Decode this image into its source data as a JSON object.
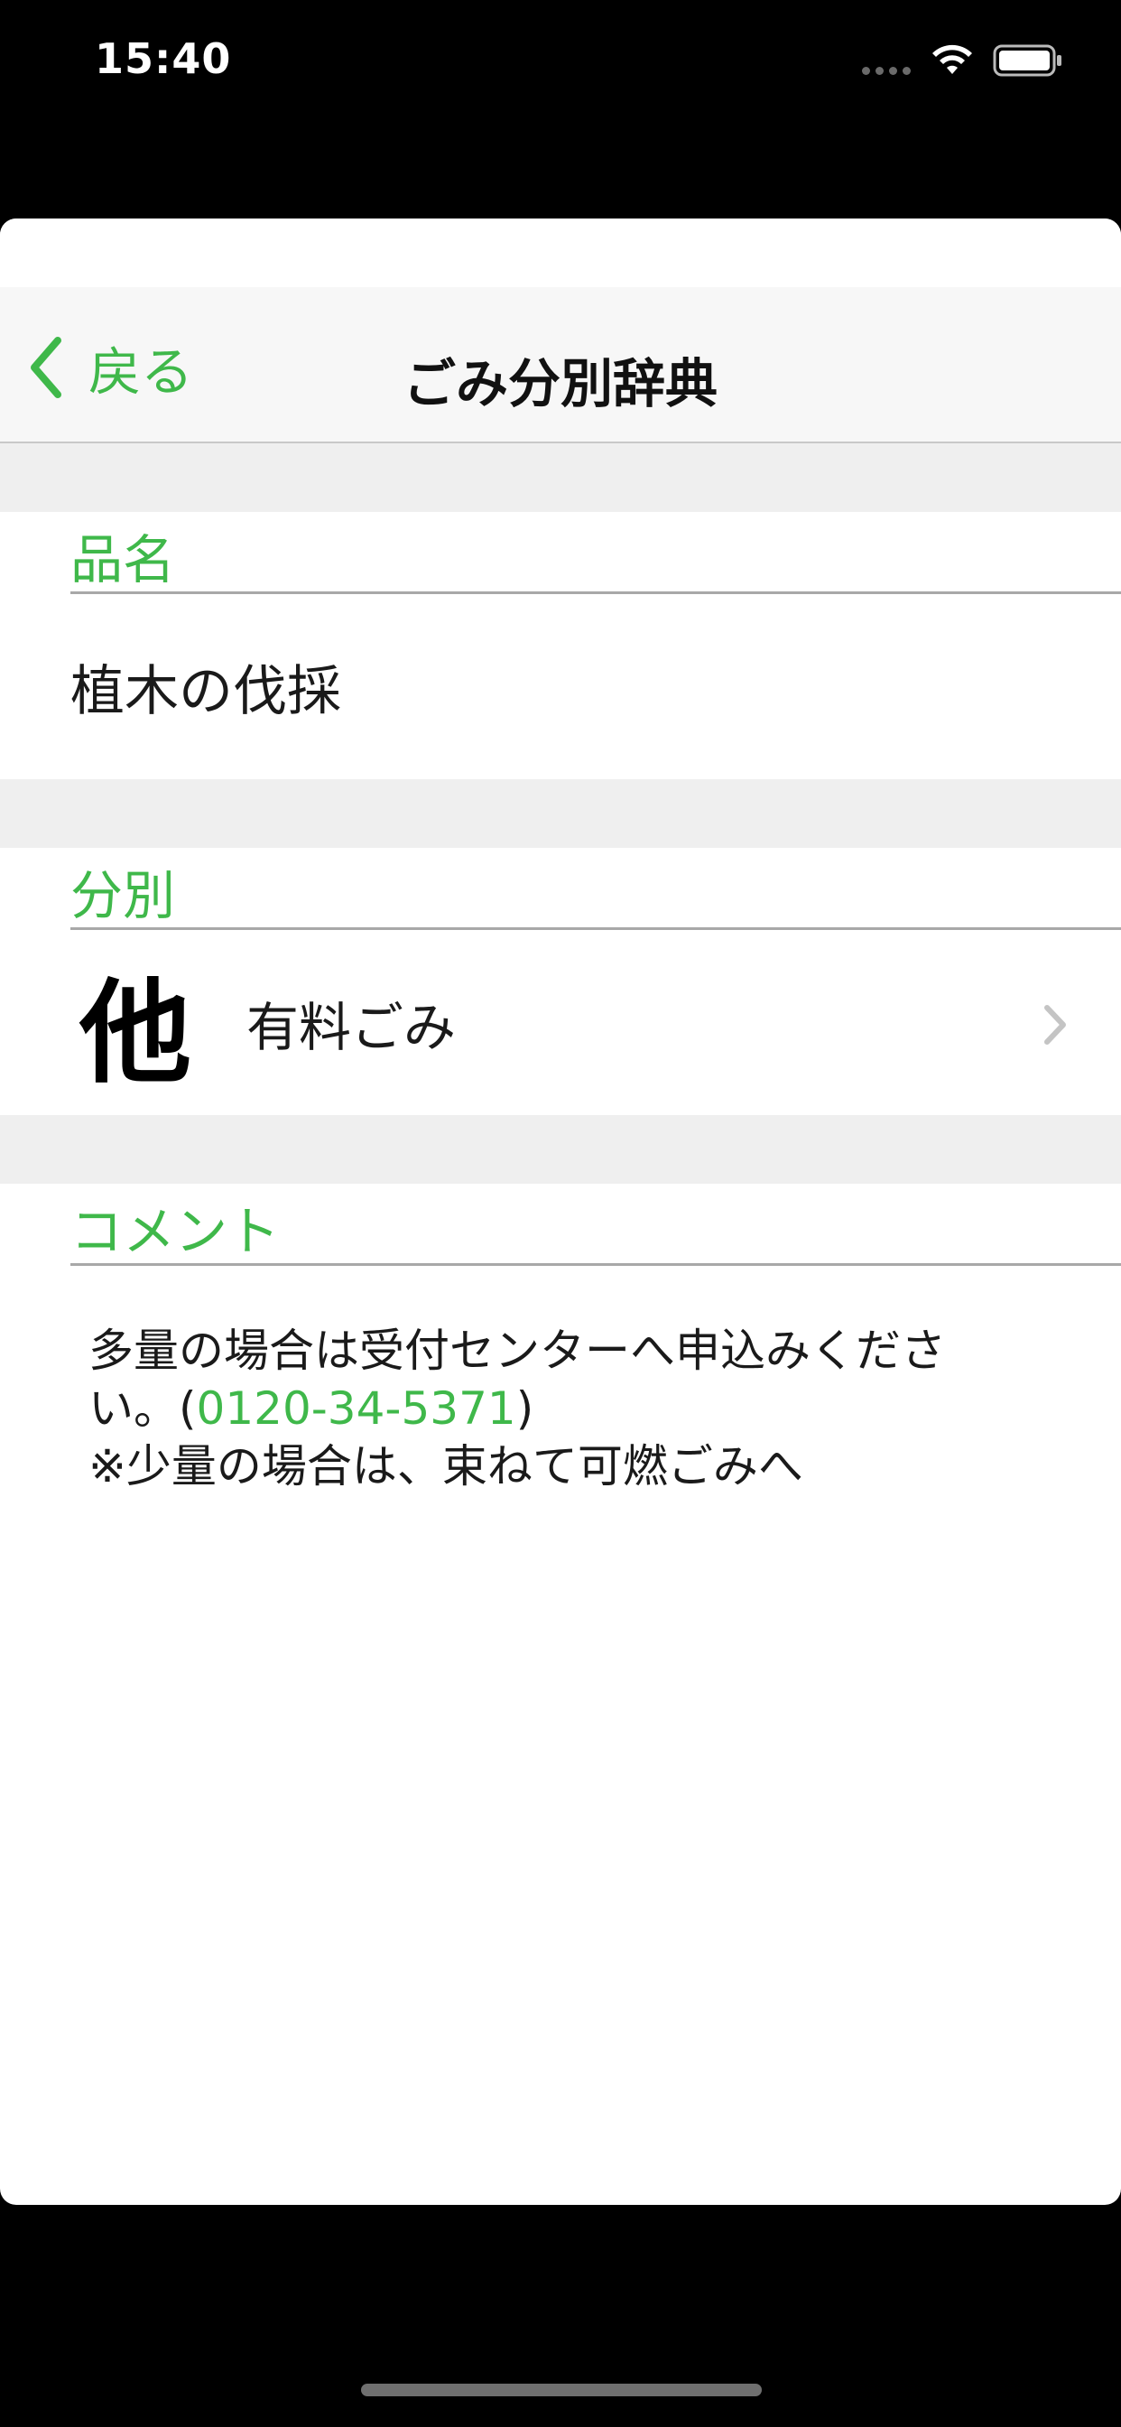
{
  "status_bar": {
    "time": "15:40",
    "icons": [
      "signal-dots-icon",
      "wifi-icon",
      "battery-icon"
    ]
  },
  "navbar": {
    "back_label": "戻る",
    "title": "ごみ分別辞典"
  },
  "item_section": {
    "header": "品名",
    "value": "植木の伐採"
  },
  "category_section": {
    "header": "分別",
    "symbol": "他",
    "label": "有料ごみ"
  },
  "comment_section": {
    "header": "コメント",
    "line1": "多量の場合は受付センターへ申込みくださ",
    "line2_prefix": "い。(",
    "phone": "0120-34-5371",
    "line2_suffix": ")",
    "line3": "※少量の場合は、束ねて可燃ごみへ"
  },
  "colors": {
    "accent": "#3fb84a",
    "background": "#000000",
    "section_gap": "#efefef",
    "navbar": "#f7f7f7"
  }
}
